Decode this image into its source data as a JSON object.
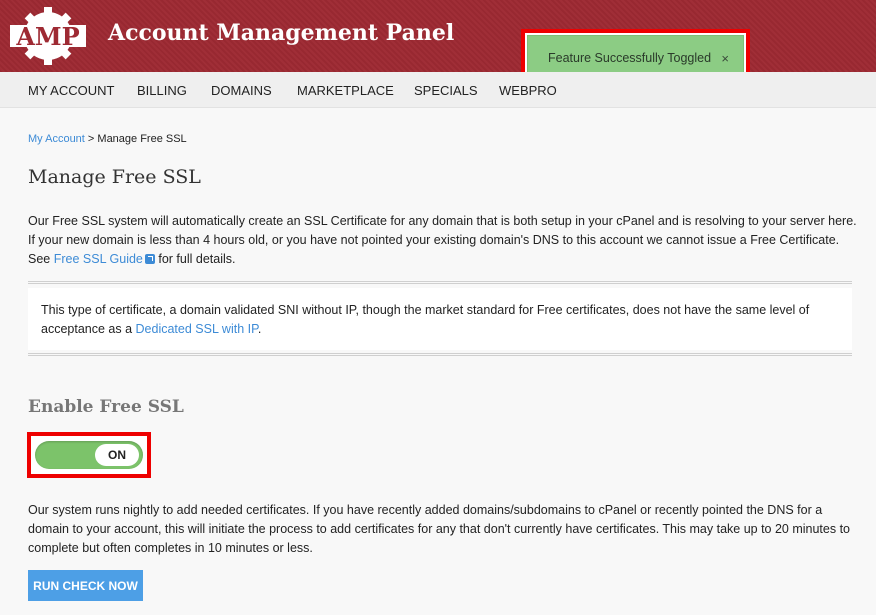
{
  "header": {
    "logo_text": "AMP",
    "title": "Account Management Panel"
  },
  "toast": {
    "message": "Feature Successfully Toggled",
    "close": "×"
  },
  "nav": {
    "items": [
      "MY ACCOUNT",
      "BILLING",
      "DOMAINS",
      "MARKETPLACE",
      "SPECIALS",
      "WEBPRO"
    ]
  },
  "breadcrumb": {
    "link": "My Account",
    "separator": " > ",
    "current": "Manage Free SSL"
  },
  "page": {
    "title": "Manage Free SSL",
    "intro_part1": "Our Free SSL system will automatically create an SSL Certificate for any domain that is both setup in your cPanel and is resolving to your server here. If your new domain is less than 4 hours old, or you have not pointed your existing domain's DNS to this account we cannot issue a Free Certificate. See ",
    "intro_link": "Free SSL Guide",
    "intro_part2": " for full details.",
    "notice_part1": "This type of certificate, a domain validated SNI without IP, though the market standard for Free certificates, does not have the same level of acceptance as a ",
    "notice_link": "Dedicated SSL with IP",
    "notice_part2": ".",
    "section_title": "Enable Free SSL",
    "toggle_label": "ON",
    "check_text": "Our system runs nightly to add needed certificates. If you have recently added domains/subdomains to cPanel or recently pointed the DNS for a domain to your account, this will initiate the process to add certificates for any that don't currently have certificates. This may take up to 20 minutes to complete but often completes in 10 minutes or less.",
    "run_button": "RUN CHECK NOW"
  },
  "colors": {
    "header_bg": "#9e2a33",
    "accent": "#3d8bd6",
    "toast_bg": "#8ccc84",
    "toggle_on": "#7cc36a",
    "button_bg": "#4d9fe6",
    "highlight": "#ee0000"
  },
  "icons": {
    "logo": "gear-logo-icon",
    "external": "external-link-icon",
    "close": "close-icon"
  }
}
